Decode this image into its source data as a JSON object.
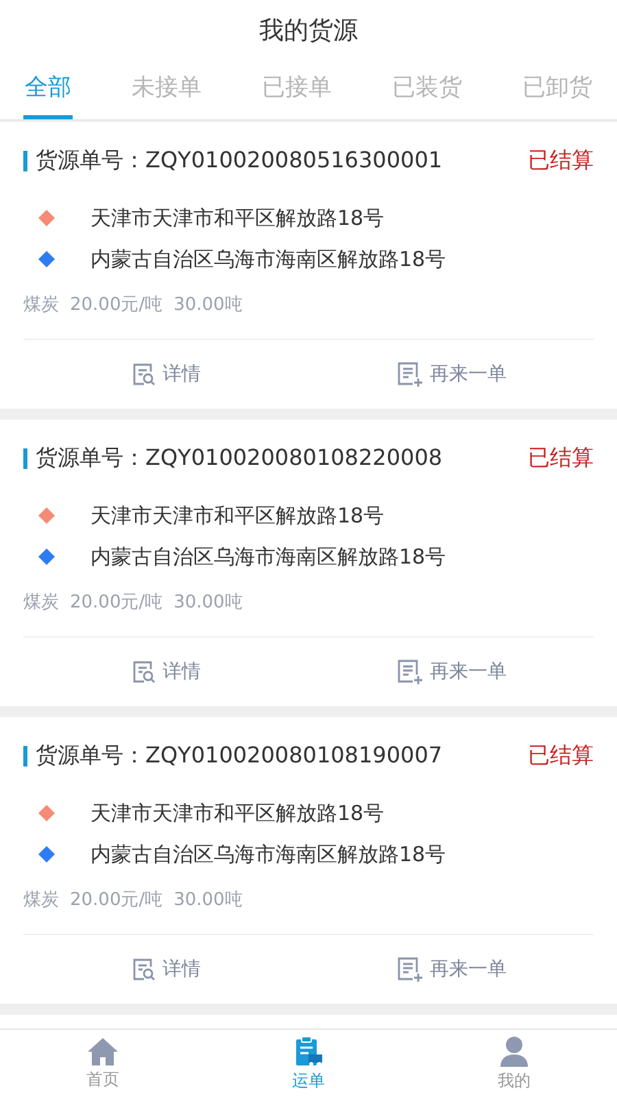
{
  "header": {
    "title": "我的货源"
  },
  "tabs": [
    {
      "label": "全部",
      "selected": true
    },
    {
      "label": "未接单",
      "selected": false
    },
    {
      "label": "已接单",
      "selected": false
    },
    {
      "label": "已装货",
      "selected": false
    },
    {
      "label": "已卸货",
      "selected": false
    }
  ],
  "orders": [
    {
      "number_label": "货源单号：ZQY010020080516300001",
      "status": "已结算",
      "origin": "天津市天津市和平区解放路18号",
      "destination": "内蒙古自治区乌海市海南区解放路18号",
      "cargo": "煤炭",
      "price": "20.00元/吨",
      "weight": "30.00吨",
      "actions": [
        "详情",
        "再来一单"
      ]
    },
    {
      "number_label": "货源单号：ZQY010020080108220008",
      "status": "已结算",
      "origin": "天津市天津市和平区解放路18号",
      "destination": "内蒙古自治区乌海市海南区解放路18号",
      "cargo": "煤炭",
      "price": "20.00元/吨",
      "weight": "30.00吨",
      "actions": [
        "详情",
        "再来一单"
      ]
    },
    {
      "number_label": "货源单号：ZQY010020080108190007",
      "status": "已结算",
      "origin": "天津市天津市和平区解放路18号",
      "destination": "内蒙古自治区乌海市海南区解放路18号",
      "cargo": "煤炭",
      "price": "20.00元/吨",
      "weight": "30.00吨",
      "actions": [
        "详情",
        "再来一单"
      ]
    }
  ],
  "bottom_nav": [
    {
      "label": "首页",
      "kind": "home",
      "selected": false
    },
    {
      "label": "运单",
      "kind": "waybill",
      "selected": true
    },
    {
      "label": "我的",
      "kind": "profile",
      "selected": false
    }
  ]
}
